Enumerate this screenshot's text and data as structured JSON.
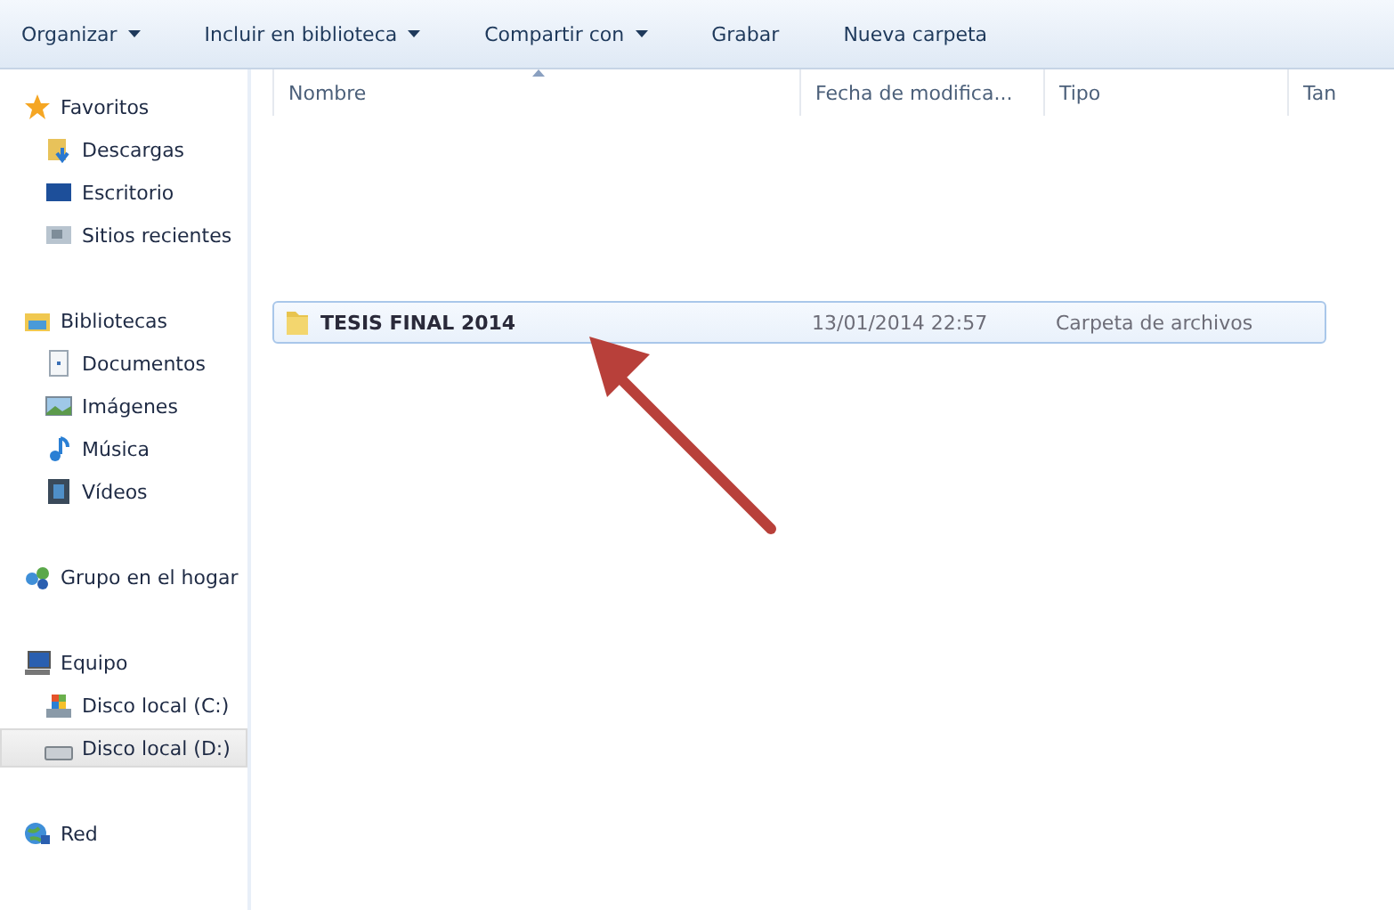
{
  "toolbar": [
    {
      "label": "Organizar",
      "dropdown": true
    },
    {
      "label": "Incluir en biblioteca",
      "dropdown": true
    },
    {
      "label": "Compartir con",
      "dropdown": true
    },
    {
      "label": "Grabar",
      "dropdown": false
    },
    {
      "label": "Nueva carpeta",
      "dropdown": false
    }
  ],
  "sidebar": [
    {
      "label": "Favoritos",
      "kind": "star",
      "selected": false,
      "children": [
        {
          "label": "Descargas",
          "kind": "downloads",
          "selected": false
        },
        {
          "label": "Escritorio",
          "kind": "desktop",
          "selected": false
        },
        {
          "label": "Sitios recientes",
          "kind": "recent",
          "selected": false
        }
      ]
    },
    {
      "label": "Bibliotecas",
      "kind": "library",
      "selected": false,
      "children": [
        {
          "label": "Documentos",
          "kind": "documents",
          "selected": false
        },
        {
          "label": "Imágenes",
          "kind": "images",
          "selected": false
        },
        {
          "label": "Música",
          "kind": "music",
          "selected": false
        },
        {
          "label": "Vídeos",
          "kind": "videos",
          "selected": false
        }
      ]
    },
    {
      "label": "Grupo en el hogar",
      "kind": "homegroup",
      "selected": false
    },
    {
      "label": "Equipo",
      "kind": "computer",
      "selected": false,
      "children": [
        {
          "label": "Disco local (C:)",
          "kind": "drive-c",
          "selected": false
        },
        {
          "label": "Disco local (D:)",
          "kind": "drive-d",
          "selected": true
        }
      ]
    },
    {
      "label": "Red",
      "kind": "network",
      "selected": false
    }
  ],
  "table": {
    "columns": [
      "Nombre",
      "Fecha de modifica...",
      "Tipo",
      "Tan"
    ],
    "rows": [
      {
        "name": "TESIS FINAL 2014",
        "date": "13/01/2014 22:57",
        "type": "Carpeta de archivos",
        "selected": true
      }
    ]
  }
}
